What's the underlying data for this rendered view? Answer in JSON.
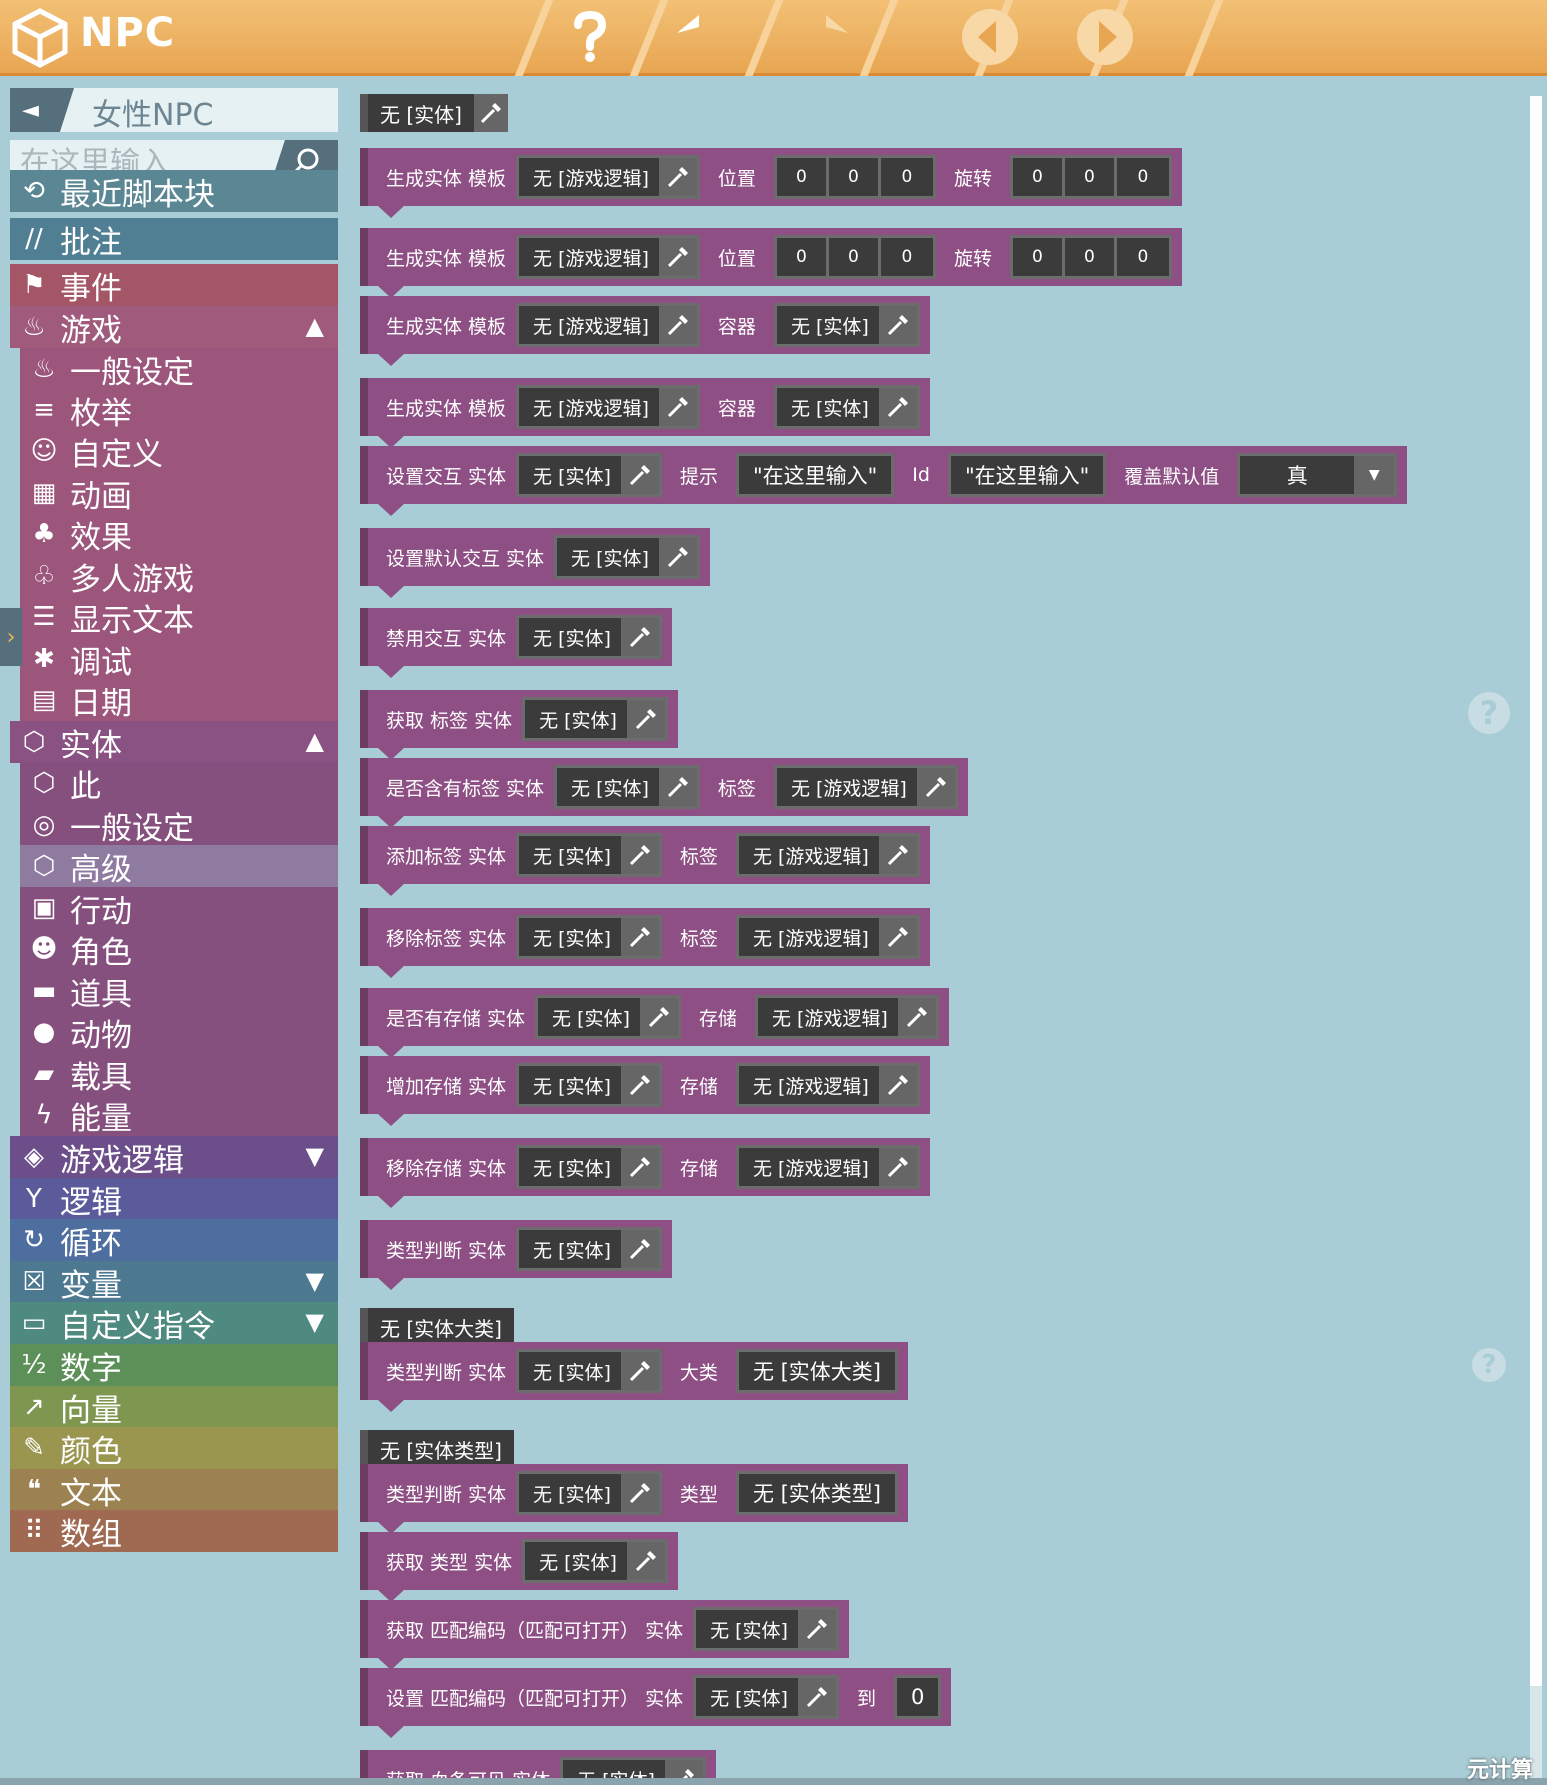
{
  "app": {
    "title": "NPC"
  },
  "toolbar": {
    "help_icon": "question-icon",
    "undo_icon": "undo-icon",
    "redo_icon": "redo-icon",
    "prev_icon": "prev-icon",
    "next_icon": "next-icon"
  },
  "sidebar": {
    "back_label": "◄",
    "title": "女性NPC",
    "search_placeholder": "在这里输入",
    "categories": [
      {
        "label": "最近脚本块",
        "color": "#5b8694",
        "icon": "clock-icon",
        "indent": false
      },
      {
        "label": "批注",
        "color": "#507f93",
        "icon": "comment-icon",
        "indent": false
      },
      {
        "label": "事件",
        "color": "#a45566",
        "icon": "event-icon",
        "indent": false
      },
      {
        "label": "游戏",
        "color": "#a05a7c",
        "icon": "joystick-icon",
        "indent": false,
        "arrow": "▲"
      },
      {
        "label": "一般设定",
        "color": "#9c567c",
        "icon": "joystick-icon",
        "indent": true
      },
      {
        "label": "枚举",
        "color": "#9c567c",
        "icon": "list-icon",
        "indent": true
      },
      {
        "label": "自定义",
        "color": "#9c567c",
        "icon": "custom-icon",
        "indent": true
      },
      {
        "label": "动画",
        "color": "#9c567c",
        "icon": "film-icon",
        "indent": true
      },
      {
        "label": "效果",
        "color": "#9c567c",
        "icon": "effect-icon",
        "indent": true
      },
      {
        "label": "多人游戏",
        "color": "#9c567c",
        "icon": "multiplayer-icon",
        "indent": true
      },
      {
        "label": "显示文本",
        "color": "#9c567c",
        "icon": "text-lines-icon",
        "indent": true
      },
      {
        "label": "调试",
        "color": "#9c567c",
        "icon": "bug-icon",
        "indent": true
      },
      {
        "label": "日期",
        "color": "#9c567c",
        "icon": "calendar-icon",
        "indent": true
      },
      {
        "label": "实体",
        "color": "#8a5282",
        "icon": "cube-icon",
        "indent": false,
        "arrow": "▲"
      },
      {
        "label": "此",
        "color": "#86507e",
        "icon": "cube-icon",
        "indent": true
      },
      {
        "label": "一般设定",
        "color": "#86507e",
        "icon": "cube-circle-icon",
        "indent": true
      },
      {
        "label": "高级",
        "color": "#8f7aa0",
        "icon": "cube-alert-icon",
        "indent": true
      },
      {
        "label": "行动",
        "color": "#86507e",
        "icon": "action-icon",
        "indent": true
      },
      {
        "label": "角色",
        "color": "#86507e",
        "icon": "head-icon",
        "indent": true
      },
      {
        "label": "道具",
        "color": "#86507e",
        "icon": "chest-icon",
        "indent": true
      },
      {
        "label": "动物",
        "color": "#86507e",
        "icon": "pig-icon",
        "indent": true
      },
      {
        "label": "载具",
        "color": "#86507e",
        "icon": "car-icon",
        "indent": true
      },
      {
        "label": "能量",
        "color": "#86507e",
        "icon": "bolt-icon",
        "indent": true
      },
      {
        "label": "游戏逻辑",
        "color": "#6c4f8a",
        "icon": "marker-icon",
        "indent": false,
        "arrow": "▼"
      },
      {
        "label": "逻辑",
        "color": "#5b5b9c",
        "icon": "branch-icon",
        "indent": false
      },
      {
        "label": "循环",
        "color": "#4f6ea0",
        "icon": "loop-icon",
        "indent": false
      },
      {
        "label": "变量",
        "color": "#4c7890",
        "icon": "variable-icon",
        "indent": false,
        "arrow": "▼"
      },
      {
        "label": "自定义指令",
        "color": "#4f8a80",
        "icon": "chat-icon",
        "indent": false,
        "arrow": "▼"
      },
      {
        "label": "数字",
        "color": "#5c9058",
        "icon": "numbers-icon",
        "indent": false
      },
      {
        "label": "向量",
        "color": "#7e9650",
        "icon": "vector-icon",
        "indent": false
      },
      {
        "label": "颜色",
        "color": "#9a9650",
        "icon": "brush-icon",
        "indent": false
      },
      {
        "label": "文本",
        "color": "#9c8250",
        "icon": "quote-icon",
        "indent": false
      },
      {
        "label": "数组",
        "color": "#a06a52",
        "icon": "grid-icon",
        "indent": false
      }
    ]
  },
  "workspace": {
    "value_chips": [
      {
        "text": "无 [实体]",
        "picker": true
      },
      {
        "text": "无 [实体大类]",
        "picker": false
      },
      {
        "text": "无 [实体类型]",
        "picker": false
      }
    ],
    "blocks": [
      {
        "label": "生成实体 模板",
        "args": [
          {
            "t": "slot",
            "v": "无 [游戏逻辑]"
          },
          {
            "t": "label",
            "v": "位置"
          },
          {
            "t": "nums",
            "v": [
              "0",
              "0",
              "0"
            ]
          },
          {
            "t": "label",
            "v": "旋转"
          },
          {
            "t": "nums",
            "v": [
              "0",
              "0",
              "0"
            ]
          }
        ]
      },
      {
        "label": "生成实体 模板",
        "args": [
          {
            "t": "slot",
            "v": "无 [游戏逻辑]"
          },
          {
            "t": "label",
            "v": "位置"
          },
          {
            "t": "nums",
            "v": [
              "0",
              "0",
              "0"
            ]
          },
          {
            "t": "label",
            "v": "旋转"
          },
          {
            "t": "nums",
            "v": [
              "0",
              "0",
              "0"
            ]
          }
        ]
      },
      {
        "label": "生成实体 模板",
        "args": [
          {
            "t": "slot",
            "v": "无 [游戏逻辑]"
          },
          {
            "t": "label",
            "v": "容器"
          },
          {
            "t": "slot",
            "v": "无 [实体]"
          }
        ]
      },
      {
        "label": "生成实体 模板",
        "args": [
          {
            "t": "slot",
            "v": "无 [游戏逻辑]"
          },
          {
            "t": "label",
            "v": "容器"
          },
          {
            "t": "slot",
            "v": "无 [实体]"
          }
        ]
      },
      {
        "label": "设置交互 实体",
        "args": [
          {
            "t": "slot",
            "v": "无 [实体]"
          },
          {
            "t": "label",
            "v": "提示"
          },
          {
            "t": "text",
            "v": "\"在这里输入\""
          },
          {
            "t": "label",
            "v": "Id"
          },
          {
            "t": "text",
            "v": "\"在这里输入\""
          },
          {
            "t": "label",
            "v": "覆盖默认值"
          },
          {
            "t": "dropdown",
            "v": "真"
          }
        ]
      },
      {
        "label": "设置默认交互 实体",
        "args": [
          {
            "t": "slot",
            "v": "无 [实体]"
          }
        ]
      },
      {
        "label": "禁用交互 实体",
        "args": [
          {
            "t": "slot",
            "v": "无 [实体]"
          }
        ]
      },
      {
        "label": "获取 标签 实体",
        "args": [
          {
            "t": "slot",
            "v": "无 [实体]"
          }
        ]
      },
      {
        "label": "是否含有标签 实体",
        "args": [
          {
            "t": "slot",
            "v": "无 [实体]"
          },
          {
            "t": "label",
            "v": "标签"
          },
          {
            "t": "slot",
            "v": "无 [游戏逻辑]"
          }
        ]
      },
      {
        "label": "添加标签 实体",
        "args": [
          {
            "t": "slot",
            "v": "无 [实体]"
          },
          {
            "t": "label",
            "v": "标签"
          },
          {
            "t": "slot",
            "v": "无 [游戏逻辑]"
          }
        ]
      },
      {
        "label": "移除标签 实体",
        "args": [
          {
            "t": "slot",
            "v": "无 [实体]"
          },
          {
            "t": "label",
            "v": "标签"
          },
          {
            "t": "slot",
            "v": "无 [游戏逻辑]"
          }
        ]
      },
      {
        "label": "是否有存储 实体",
        "args": [
          {
            "t": "slot",
            "v": "无 [实体]"
          },
          {
            "t": "label",
            "v": "存储"
          },
          {
            "t": "slot",
            "v": "无 [游戏逻辑]"
          }
        ]
      },
      {
        "label": "增加存储 实体",
        "args": [
          {
            "t": "slot",
            "v": "无 [实体]"
          },
          {
            "t": "label",
            "v": "存储"
          },
          {
            "t": "slot",
            "v": "无 [游戏逻辑]"
          }
        ]
      },
      {
        "label": "移除存储 实体",
        "args": [
          {
            "t": "slot",
            "v": "无 [实体]"
          },
          {
            "t": "label",
            "v": "存储"
          },
          {
            "t": "slot",
            "v": "无 [游戏逻辑]"
          }
        ]
      },
      {
        "label": "类型判断 实体",
        "args": [
          {
            "t": "slot",
            "v": "无 [实体]"
          }
        ]
      },
      {
        "label": "类型判断 实体",
        "args": [
          {
            "t": "slot",
            "v": "无 [实体]"
          },
          {
            "t": "label",
            "v": "大类"
          },
          {
            "t": "text",
            "v": "无 [实体大类]"
          }
        ]
      },
      {
        "label": "类型判断 实体",
        "args": [
          {
            "t": "slot",
            "v": "无 [实体]"
          },
          {
            "t": "label",
            "v": "类型"
          },
          {
            "t": "text",
            "v": "无 [实体类型]"
          }
        ]
      },
      {
        "label": "获取 类型 实体",
        "args": [
          {
            "t": "slot",
            "v": "无 [实体]"
          }
        ]
      },
      {
        "label": "获取 匹配编码（匹配可打开） 实体",
        "args": [
          {
            "t": "slot",
            "v": "无 [实体]"
          }
        ]
      },
      {
        "label": "设置 匹配编码（匹配可打开） 实体",
        "args": [
          {
            "t": "slot",
            "v": "无 [实体]"
          },
          {
            "t": "label",
            "v": "到"
          },
          {
            "t": "text",
            "v": "0"
          }
        ]
      },
      {
        "label": "获取 血条可见 实体",
        "args": [
          {
            "t": "slot",
            "v": "无 [实体]"
          }
        ]
      }
    ]
  },
  "watermark": "元计算"
}
